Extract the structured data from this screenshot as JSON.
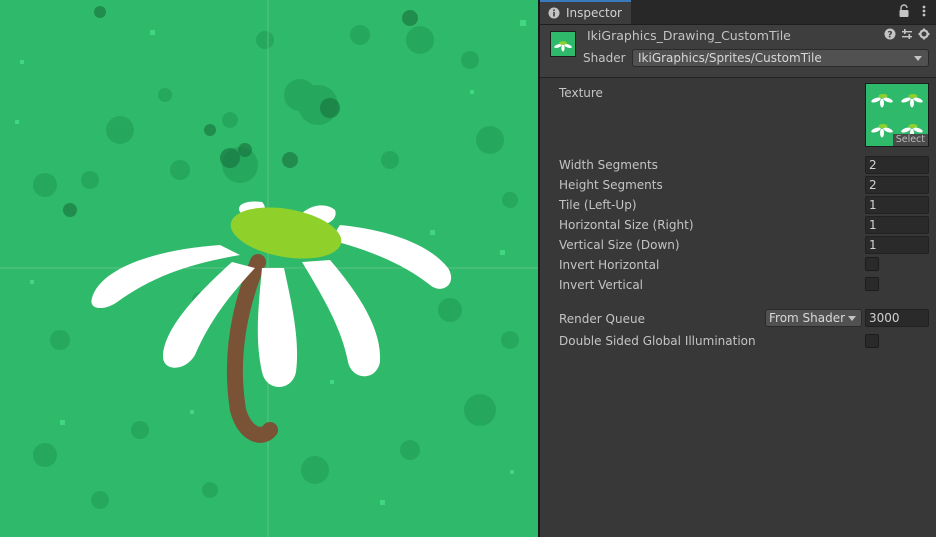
{
  "inspector": {
    "tab_label": "Inspector",
    "material_name": "IkiGraphics_Drawing_CustomTile",
    "shader_label": "Shader",
    "shader_value": "IkiGraphics/Sprites/CustomTile"
  },
  "texture": {
    "label": "Texture",
    "select_label": "Select"
  },
  "properties": [
    {
      "label": "Width Segments",
      "value": "2"
    },
    {
      "label": "Height Segments",
      "value": "2"
    },
    {
      "label": "Tile (Left-Up)",
      "value": "1"
    },
    {
      "label": "Horizontal Size (Right)",
      "value": "1"
    },
    {
      "label": "Vertical Size (Down)",
      "value": "1"
    }
  ],
  "toggles": [
    {
      "label": "Invert Horizontal",
      "checked": false
    },
    {
      "label": "Invert Vertical",
      "checked": false
    }
  ],
  "render_queue": {
    "label": "Render Queue",
    "mode": "From Shader",
    "value": "3000"
  },
  "double_sided_gi": {
    "label": "Double Sided Global Illumination",
    "checked": false
  },
  "colors": {
    "scene_background": "#2fb96a",
    "petal": "#ffffff",
    "flower_center": "#8fd12a",
    "stem": "#7a5236",
    "panel": "#383838",
    "accent": "#3a79bb"
  },
  "icons": {
    "tab": "info-icon",
    "lock": "lock-icon",
    "menu": "kebab-menu-icon",
    "help": "help-icon",
    "presets": "presets-sliders-icon",
    "settings": "gear-icon"
  }
}
